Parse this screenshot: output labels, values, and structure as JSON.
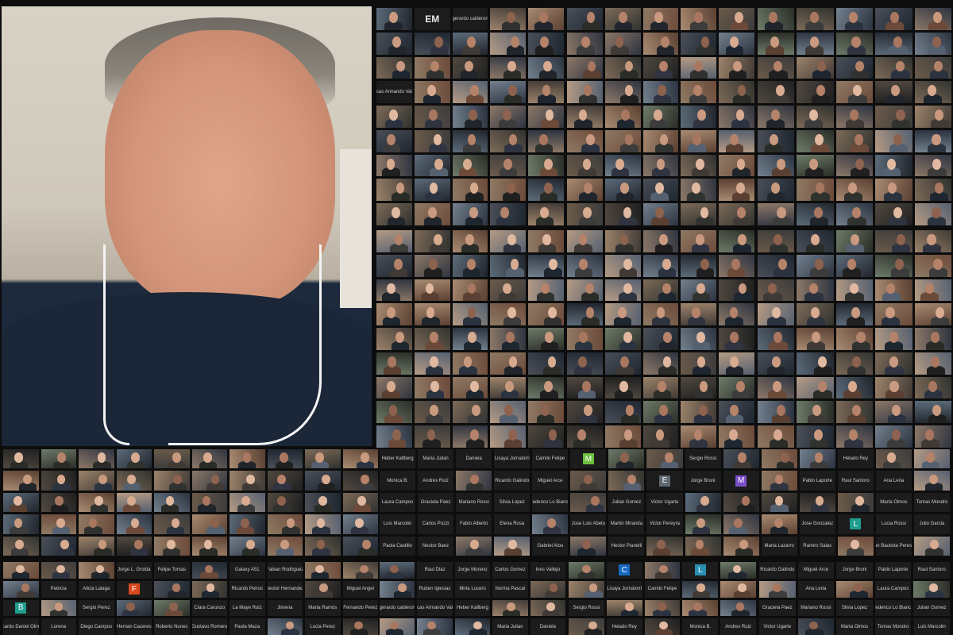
{
  "colors": {
    "background": "#0d0d0d",
    "tile_empty": "#1c1c1c",
    "tile_text": "#cfcfcf"
  },
  "speaker": {
    "role": "active speaker video"
  },
  "badges": {
    "em": "EM",
    "m1": "M",
    "m2": "M",
    "e": "E",
    "l1": "L",
    "c": "C",
    "f": "F",
    "b": "B",
    "l2": "L"
  },
  "names": [
    "gerardo calderon",
    "Lucas Armando Valdo",
    "Heber Kallberg",
    "Maria Julian",
    "Daniela",
    "Lisaya Jornalorri",
    "Camilo Felipe",
    "Sergio Rossi",
    "Helado Rey",
    "Monica B.",
    "Andres Ruiz",
    "Ricardo Galindo",
    "Miguel Arce",
    "Jorge Bruni",
    "Pablo Laporte",
    "Raul Santoro",
    "Ana Leria",
    "Laura Campos",
    "Graciela Paez",
    "Mariano Rossi",
    "Silvia Lopez",
    "Federico Lo Bianco",
    "Julian Gomez",
    "Victor Ugarte",
    "Marta Olmos",
    "Tomas Mondro",
    "Luis Marcolin",
    "Carlos Pozzi",
    "Fabio Alberto",
    "Elena Rosa",
    "Jose Luis Abeto",
    "Martin Miranda",
    "Victor Pereyra",
    "Jose Gonzalez",
    "Lucia Rossi",
    "Julio Garcia",
    "Paola Castillo",
    "Nestor Baez",
    "Gabriel Alou",
    "Hector Pianelli",
    "Marta Lazarro",
    "Ramiro Salas",
    "Juan Bautista Peresgal",
    "Jorge L. Grolda",
    "Felipe Tomas",
    "Galaxy A51",
    "Fabian Rodriguez",
    "Patricia",
    "Alicia Lalaga",
    "Ricardo Peiros",
    "Nestor Hernandez",
    "Miguel Angel",
    "Sergio Perez",
    "Clara Carunzo",
    "La Maye Ruiz",
    "Jimena",
    "Marta Ramos",
    "Fernando Perez",
    "Ricardo Daniel Olmos",
    "Lorena",
    "Diego Campos",
    "Hernan Caceres",
    "Roberto Nunes",
    "Gustavo Romero",
    "Paola Maza",
    "Lucia Perez",
    "Raul Diaz",
    "Jorge Moreno",
    "Carlos Gomez",
    "Ines Vallejo",
    "Ruben Iglesias",
    "Mirta Lucero",
    "Norma Pascal"
  ]
}
